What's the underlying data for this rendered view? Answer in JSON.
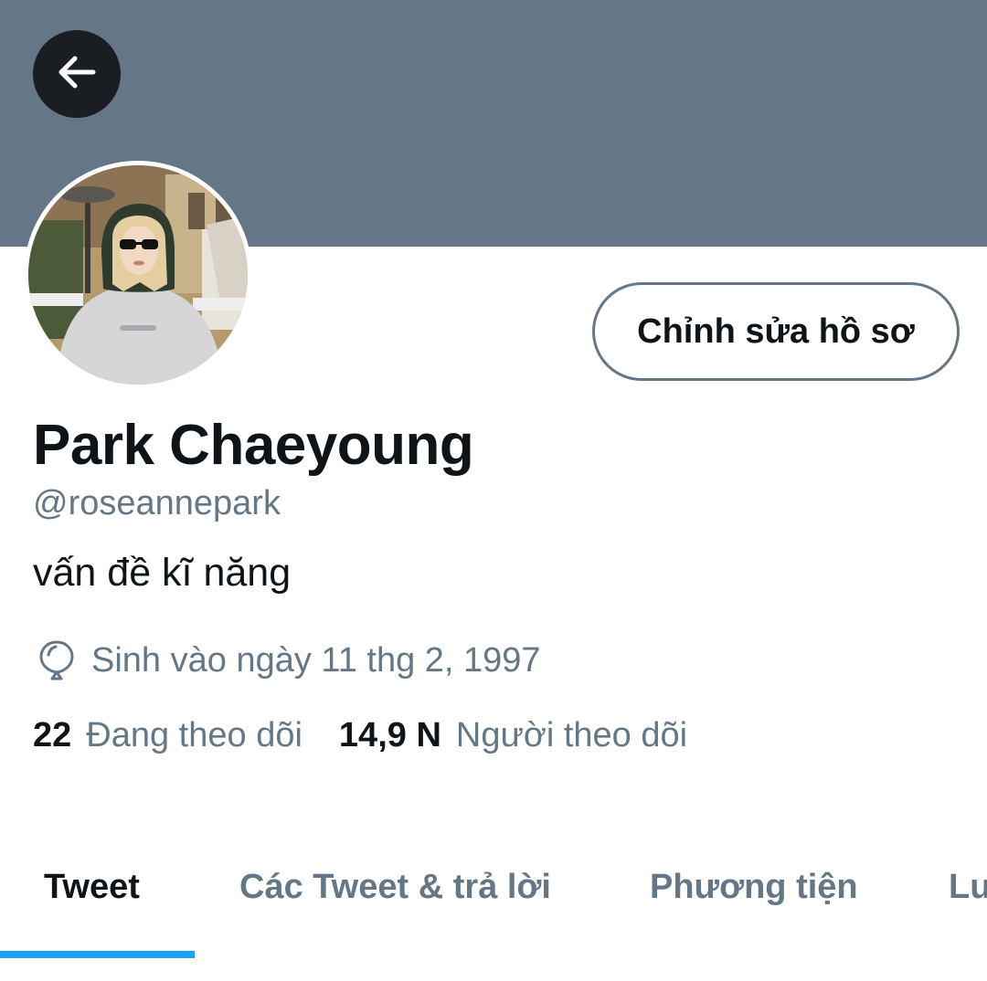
{
  "header": {
    "back_icon": "arrow-left-icon",
    "banner_color": "#657786"
  },
  "profile": {
    "name": "Park Chaeyoung",
    "handle": "@roseannepark",
    "bio": "vấn đề kĩ năng",
    "birth_icon": "balloon-icon",
    "birth_text": "Sinh vào ngày 11 thg 2, 1997",
    "edit_label": "Chỉnh sửa hồ sơ"
  },
  "stats": {
    "following_count": "22",
    "following_label": "Đang theo dõi",
    "followers_count": "14,9 N",
    "followers_label": "Người theo dõi"
  },
  "tabs": [
    {
      "label": "Tweet",
      "active": true
    },
    {
      "label": "Các Tweet & trả lời",
      "active": false
    },
    {
      "label": "Phương tiện",
      "active": false
    },
    {
      "label": "Lư",
      "active": false
    }
  ],
  "colors": {
    "accent": "#1da1f2",
    "text_primary": "#0f1419",
    "text_secondary": "#657786"
  }
}
